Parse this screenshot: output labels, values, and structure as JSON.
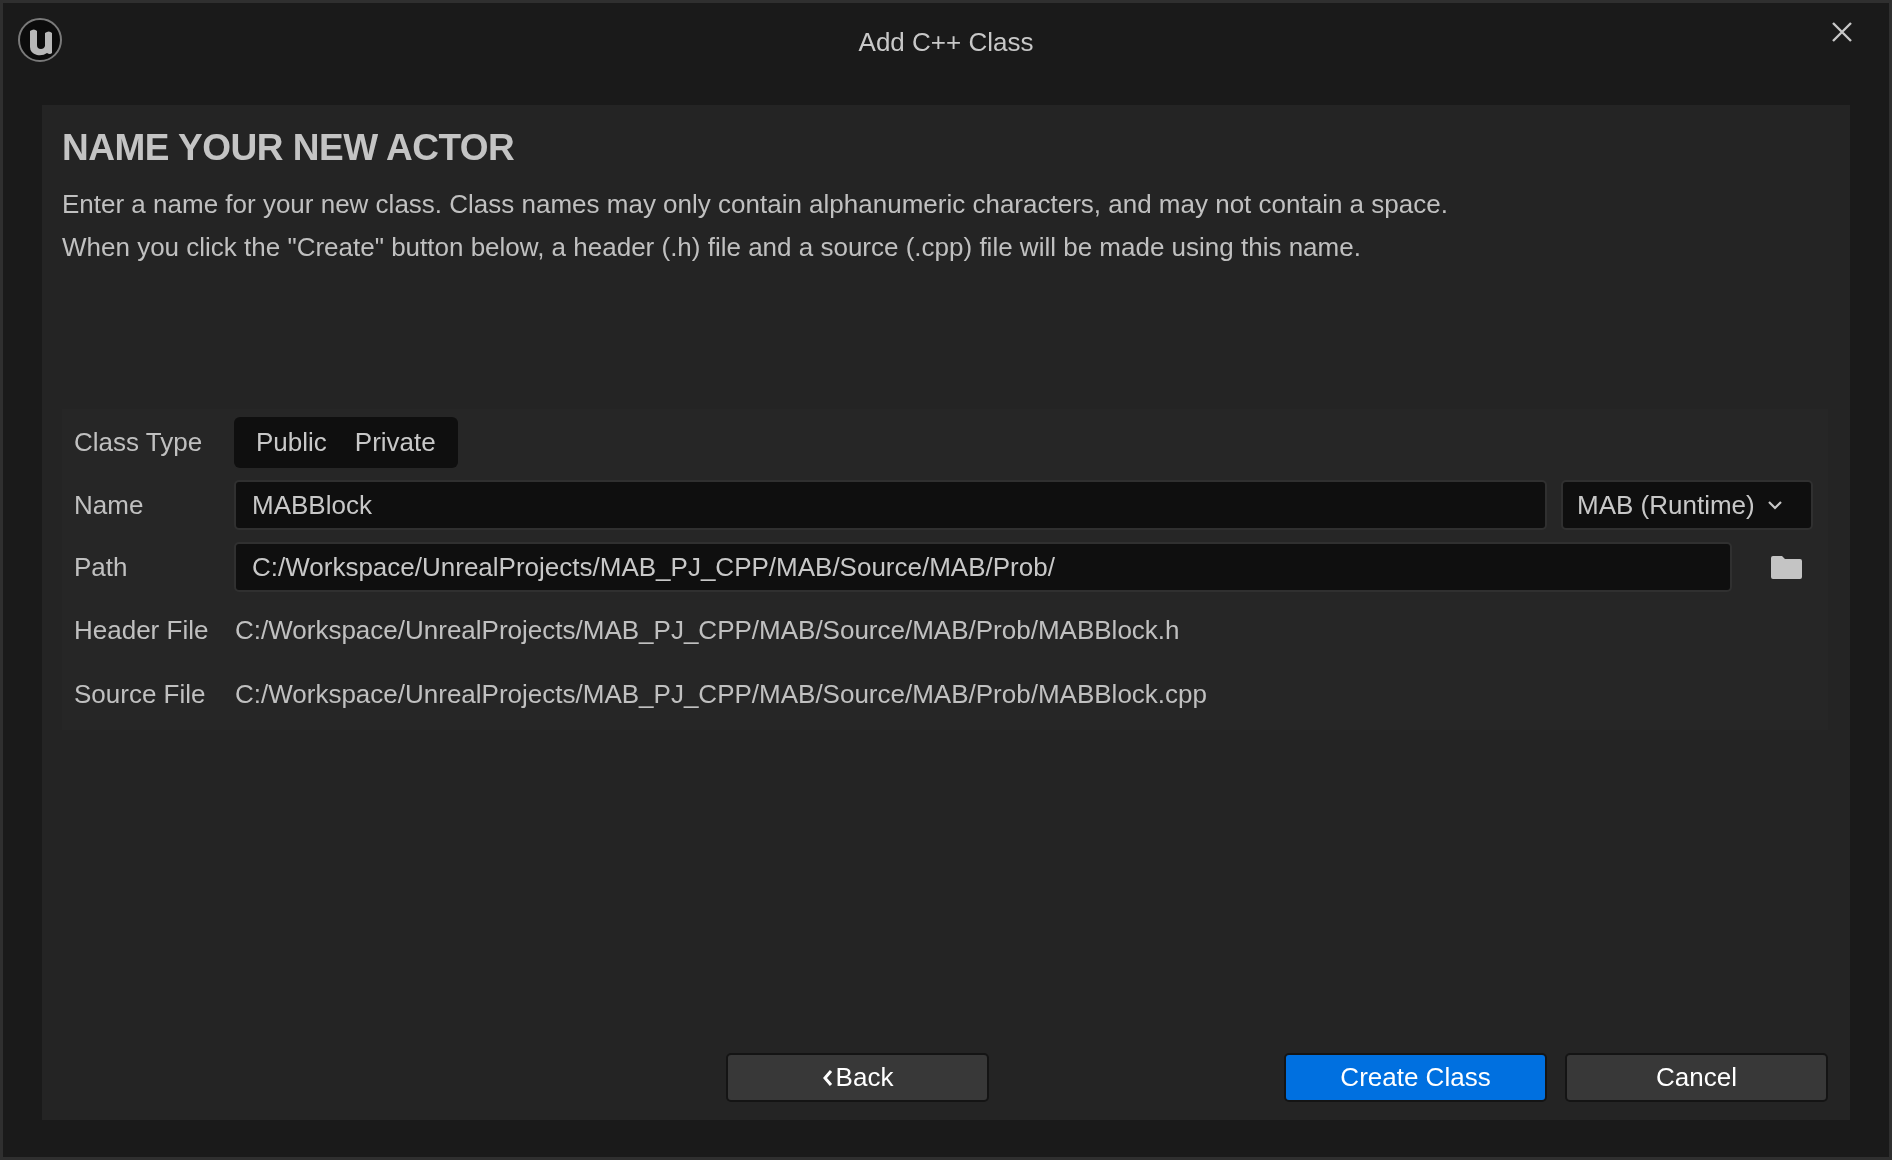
{
  "window": {
    "title": "Add C++ Class"
  },
  "heading": "NAME YOUR NEW ACTOR",
  "description": [
    "Enter a name for your new class. Class names may only contain alphanumeric characters, and may not contain a space.",
    "When you click the \"Create\" button below, a header (.h) file and a source (.cpp) file will be made using this name."
  ],
  "class_type": {
    "label": "Class Type",
    "options": [
      {
        "label": "Public",
        "selected": false
      },
      {
        "label": "Private",
        "selected": false
      }
    ]
  },
  "name": {
    "label": "Name",
    "value": "MABBlock",
    "module": "MAB (Runtime)"
  },
  "path": {
    "label": "Path",
    "value": "C:/Workspace/UnrealProjects/MAB_PJ_CPP/MAB/Source/MAB/Prob/"
  },
  "files": [
    {
      "label": "Header File",
      "value": "C:/Workspace/UnrealProjects/MAB_PJ_CPP/MAB/Source/MAB/Prob/MABBlock.h"
    },
    {
      "label": "Source File",
      "value": "C:/Workspace/UnrealProjects/MAB_PJ_CPP/MAB/Source/MAB/Prob/MABBlock.cpp"
    }
  ],
  "buttons": [
    {
      "label": "Back",
      "kind": "back"
    },
    {
      "label": "Create Class",
      "kind": "primary"
    },
    {
      "label": "Cancel",
      "kind": "normal"
    }
  ]
}
